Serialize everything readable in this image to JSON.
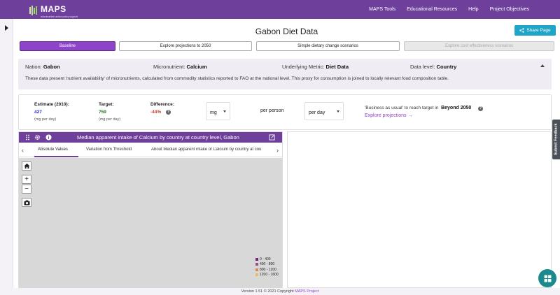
{
  "app": {
    "logo_text": "MAPS",
    "logo_subtitle": "micronutrient action policy support"
  },
  "nav": {
    "links": [
      "MAPS Tools",
      "Educational Resources",
      "Help",
      "Project Objectives"
    ]
  },
  "page": {
    "title": "Gabon Diet Data",
    "share_label": "Share Page"
  },
  "tabs": [
    {
      "label": "Baseline",
      "state": "active"
    },
    {
      "label": "Explore projections to 2050",
      "state": "normal"
    },
    {
      "label": "Simple dietary change scenarios",
      "state": "normal"
    },
    {
      "label": "Explore cost effectiveness scenarios",
      "state": "disabled"
    }
  ],
  "info": {
    "nation_label": "Nation:",
    "nation_value": "Gabon",
    "micronutrient_label": "Micronutrient:",
    "micronutrient_value": "Calcium",
    "metric_label": "Underlying Metric:",
    "metric_value": "Diet Data",
    "level_label": "Data level:",
    "level_value": "Country",
    "description": "These data present 'nutrient availability' of micronutrients, calculated from commodity statistics reported to FAO at the national level. This proxy for consumption is joined to locally relevant food composition table."
  },
  "stats": {
    "estimate_label": "Estimate (2010):",
    "estimate_value": "427",
    "estimate_unit": "(mg per day)",
    "target_label": "Target:",
    "target_value": "759",
    "target_unit": "(mg per day)",
    "difference_label": "Difference:",
    "difference_value": "-44%",
    "unit_select": "mg",
    "per_person": "per person",
    "period_select": "per day",
    "bau_text": "'Business as usual' to reach target in",
    "bau_value": "Beyond 2050",
    "explore_link": "Explore projections"
  },
  "map_panel": {
    "title": "Median apparent intake of Calcium by country at country level, Gabon",
    "subtabs": [
      "Absolute Values",
      "Variation from Threshold",
      "About Median apparent intake of Calcium by country at cou"
    ],
    "legend": [
      {
        "label": "0 - 400",
        "color": "#7a1f7a"
      },
      {
        "label": "400 - 800",
        "color": "#a0527c"
      },
      {
        "label": "800 - 1200",
        "color": "#d68a5a"
      },
      {
        "label": "1200 - 1600",
        "color": "#e8c05a"
      }
    ]
  },
  "feedback_label": "Submit Feedback",
  "footer": {
    "version": "Version 1.51 © 2021 Copyright",
    "link": "MAPS Project"
  },
  "colors": {
    "brand_purple": "#6f3f9c",
    "active_tab": "#8e44c8",
    "share_button": "#1ea5c7",
    "estimate_blue": "#2a2acc",
    "target_green": "#1f7a1f",
    "difference_red": "#c0392b",
    "fab_teal": "#1b8a8c"
  }
}
